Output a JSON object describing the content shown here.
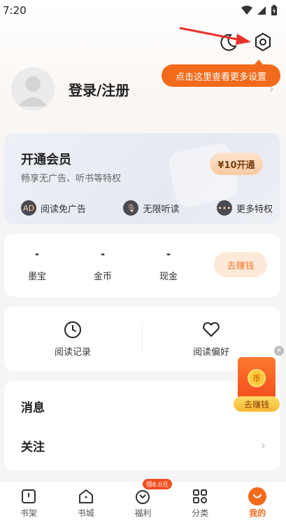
{
  "status_bar": {
    "time": "7:20"
  },
  "tooltip": {
    "text": "点击这里查看更多设置"
  },
  "profile": {
    "login_label": "登录/注册"
  },
  "vip": {
    "title": "开通会员",
    "subtitle": "畅享无广告、听书等特权",
    "button_label": "¥10开通",
    "perks": [
      {
        "label": "阅读免广告",
        "icon": "ad-free-icon",
        "glyph": "AD"
      },
      {
        "label": "无限听读",
        "icon": "microphone-icon",
        "glyph": "🎙"
      },
      {
        "label": "更多特权",
        "icon": "more-dots-icon",
        "glyph": "•••"
      }
    ]
  },
  "assets": {
    "items": [
      {
        "value": "-",
        "label": "墨宝"
      },
      {
        "value": "-",
        "label": "金币"
      },
      {
        "value": "-",
        "label": "现金"
      }
    ],
    "earn_label": "去赚钱"
  },
  "records": {
    "history_label": "阅读记录",
    "preference_label": "阅读偏好"
  },
  "messages": {
    "items": [
      {
        "label": "消息"
      },
      {
        "label": "关注"
      }
    ]
  },
  "float_ad": {
    "coin_glyph": "币",
    "label": "去赚钱",
    "close": "×"
  },
  "bottom_nav": {
    "items": [
      {
        "label": "书架"
      },
      {
        "label": "书城"
      },
      {
        "label": "福利",
        "badge": "领8.0元"
      },
      {
        "label": "分类"
      },
      {
        "label": "我的"
      }
    ]
  },
  "colors": {
    "accent": "#f26a1b"
  }
}
